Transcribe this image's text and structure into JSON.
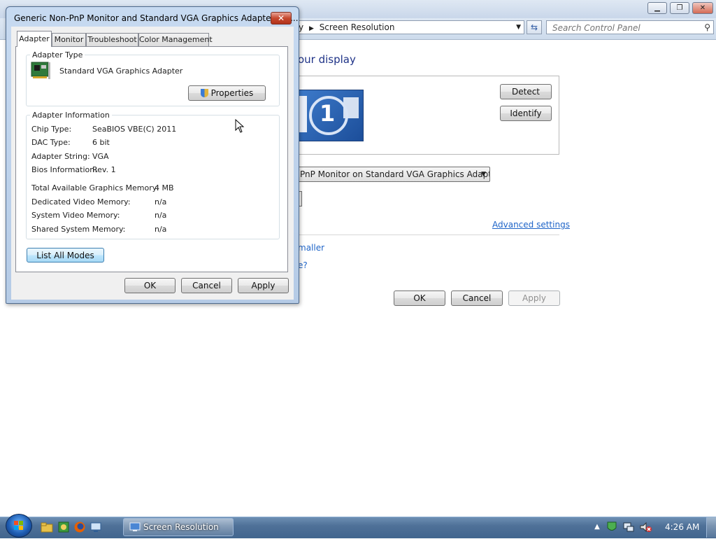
{
  "background_window": {
    "address_crumb_partial": "y",
    "address_current": "Screen Resolution",
    "search_placeholder": "Search Control Panel",
    "heading_partial": "our display",
    "detect_label": "Detect",
    "identify_label": "Identify",
    "monitor_number": "1",
    "display_select_value": "PnP Monitor on Standard VGA Graphics Adapter",
    "advanced_link": "Advanced settings",
    "link_smaller_partial": "maller",
    "link_question_partial": "e?",
    "ok_label": "OK",
    "cancel_label": "Cancel",
    "apply_label": "Apply"
  },
  "dialog": {
    "title": "Generic Non-PnP Monitor and Standard VGA Graphics Adapter Pro...",
    "close_glyph": "✕",
    "tabs": [
      {
        "label": "Adapter",
        "active": true
      },
      {
        "label": "Monitor",
        "active": false
      },
      {
        "label": "Troubleshoot",
        "active": false
      },
      {
        "label": "Color Management",
        "active": false
      }
    ],
    "adapter_type": {
      "legend": "Adapter Type",
      "name": "Standard VGA Graphics Adapter",
      "properties_label": "Properties"
    },
    "adapter_info": {
      "legend": "Adapter Information",
      "rows": [
        {
          "label": "Chip Type:",
          "value": "SeaBIOS VBE(C) 2011"
        },
        {
          "label": "DAC Type:",
          "value": "6 bit"
        },
        {
          "label": "Adapter String:",
          "value": "VGA"
        },
        {
          "label": "Bios Information:",
          "value": "Rev. 1"
        }
      ],
      "memory_rows": [
        {
          "label": "Total Available Graphics Memory:",
          "value": "4 MB"
        },
        {
          "label": "Dedicated Video Memory:",
          "value": "n/a"
        },
        {
          "label": "System Video Memory:",
          "value": "n/a"
        },
        {
          "label": "Shared System Memory:",
          "value": "n/a"
        }
      ]
    },
    "list_all_modes_label": "List All Modes",
    "ok_label": "OK",
    "cancel_label": "Cancel",
    "apply_label": "Apply"
  },
  "taskbar": {
    "task_label": "Screen Resolution",
    "clock": "4:26 AM"
  },
  "colors": {
    "link": "#1e64c8",
    "heading": "#1e3287",
    "taskbar": "#4f7198",
    "close_button": "#c6482f"
  }
}
